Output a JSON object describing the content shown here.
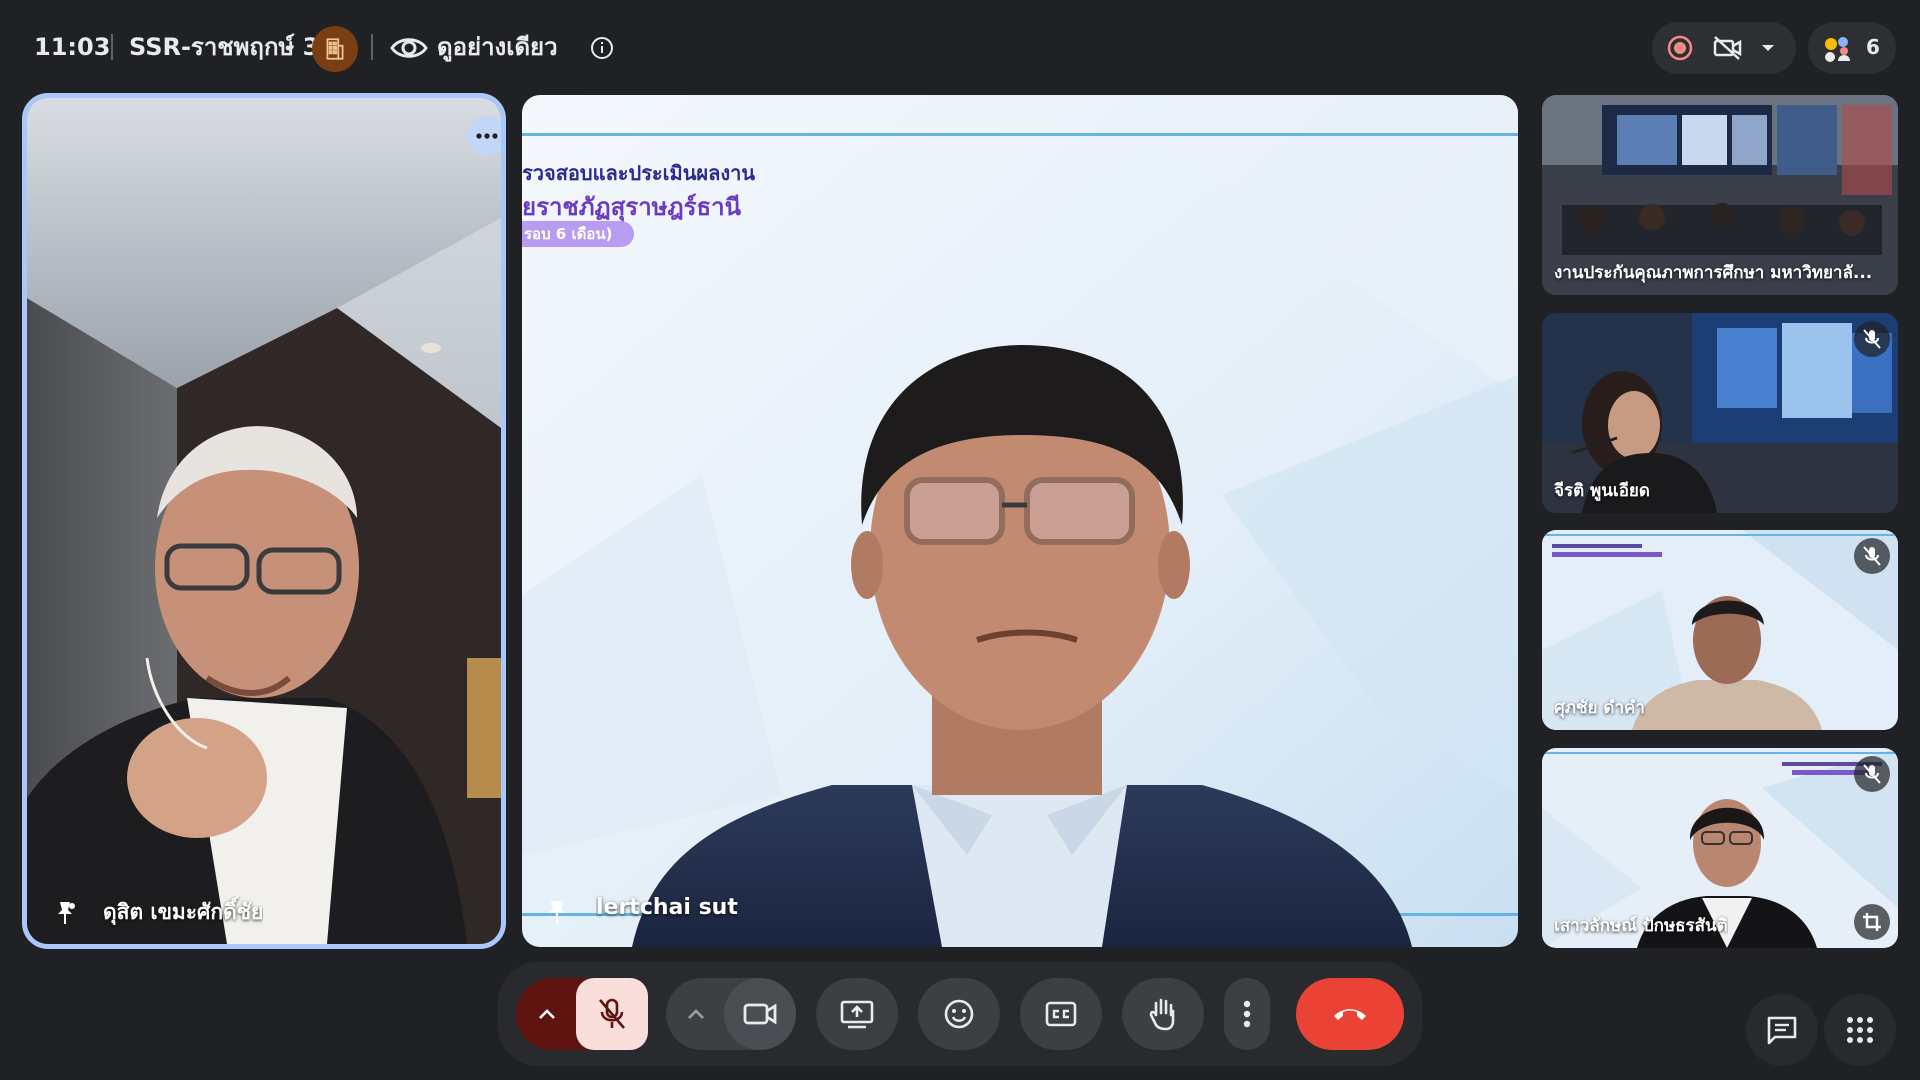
{
  "topbar": {
    "time": "11:03",
    "room_name": "SSR-ราชพฤกษ์ 3",
    "view_mode_label": "ดูอย่างเดียว",
    "participant_count": "6",
    "icons": [
      "building-icon",
      "eye-icon",
      "info-icon",
      "record-icon",
      "no-video-icon",
      "dropdown-icon",
      "participants-icon"
    ]
  },
  "tiles": {
    "left": {
      "name": "ดุสิต เขมะศักดิ์ชัย",
      "icons": [
        "more-options-icon",
        "pin-icon"
      ]
    },
    "main": {
      "name": "lertchai sut",
      "slide_line1": "รวจสอบและประเมินผลงาน",
      "slide_line2": "ยราชภัฏสุราษฎร์ธานี",
      "slide_tag": "รอบ 6 เดือน)",
      "icons": [
        "pin-icon"
      ]
    },
    "side": [
      {
        "name": "งานประกันคุณภาพการศึกษา มหาวิทยาลั..."
      },
      {
        "name": "จีรติ พูนเอียด",
        "muted": true
      },
      {
        "name": "ศุภชัย ดำคำ",
        "muted": true
      },
      {
        "name": "เสาวลักษณ์ ปักษธรสันติ",
        "muted": true
      }
    ]
  },
  "controls": {
    "buttons": [
      "mic-options",
      "mic-off",
      "camera-options",
      "camera",
      "present",
      "emoji",
      "captions",
      "raise-hand",
      "more-options",
      "leave-call"
    ],
    "colors": {
      "mic_off_bg": "#f9dedc",
      "mic_chevron_bg": "#601410",
      "leave_bg": "#ea4335",
      "bar_bg": "#292a2d"
    }
  },
  "colors": {
    "background": "#202124",
    "active_speaker_border": "#a8c7fa",
    "room_badge": "#7a3e12",
    "slide_text": "#6a3bc2"
  }
}
